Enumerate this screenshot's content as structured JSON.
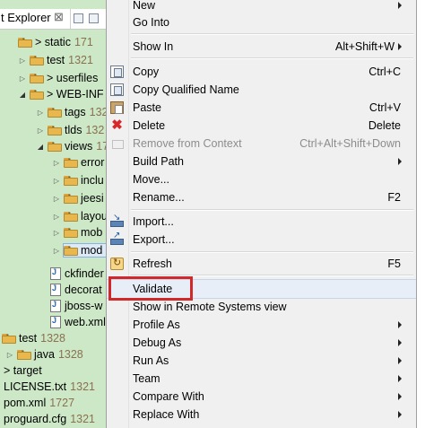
{
  "explorer": {
    "title": "t Explorer",
    "close_glyph": "⊠",
    "items": [
      {
        "name": "> static",
        "count": "171"
      },
      {
        "name": "test",
        "count": "1321"
      },
      {
        "name": "> userfiles",
        "count": ""
      },
      {
        "name": "> WEB-INF",
        "count": "17"
      },
      {
        "name": "tags",
        "count": "132"
      },
      {
        "name": "tlds",
        "count": "132"
      },
      {
        "name": "views",
        "count": "17"
      },
      {
        "name": "error",
        "count": ""
      },
      {
        "name": "inclu",
        "count": ""
      },
      {
        "name": "jeesi",
        "count": ""
      },
      {
        "name": "layou",
        "count": ""
      },
      {
        "name": "mob",
        "count": ""
      },
      {
        "name": "mod",
        "count": ""
      },
      {
        "name": "ckfinder",
        "count": ""
      },
      {
        "name": "decorat",
        "count": ""
      },
      {
        "name": "jboss-w",
        "count": ""
      },
      {
        "name": "web.xml",
        "count": ""
      },
      {
        "name": "test",
        "count": "1328"
      },
      {
        "name": "java",
        "count": "1328"
      },
      {
        "name": "> target",
        "count": ""
      },
      {
        "name": "LICENSE.txt",
        "count": "1321"
      },
      {
        "name": "pom.xml",
        "count": "1727"
      },
      {
        "name": "proguard.cfg",
        "count": "1321"
      }
    ]
  },
  "menu": {
    "new": {
      "label": "New"
    },
    "go_into": {
      "label": "Go Into"
    },
    "show_in": {
      "label": "Show In",
      "shortcut": "Alt+Shift+W"
    },
    "copy": {
      "label": "Copy",
      "shortcut": "Ctrl+C"
    },
    "copy_qualified": {
      "label": "Copy Qualified Name"
    },
    "paste": {
      "label": "Paste",
      "shortcut": "Ctrl+V"
    },
    "delete": {
      "label": "Delete",
      "shortcut": "Delete"
    },
    "remove_context": {
      "label": "Remove from Context",
      "shortcut": "Ctrl+Alt+Shift+Down"
    },
    "build_path": {
      "label": "Build Path"
    },
    "move": {
      "label": "Move..."
    },
    "rename": {
      "label": "Rename...",
      "shortcut": "F2"
    },
    "import": {
      "label": "Import..."
    },
    "export": {
      "label": "Export..."
    },
    "refresh": {
      "label": "Refresh",
      "shortcut": "F5"
    },
    "validate": {
      "label": "Validate"
    },
    "show_remote": {
      "label": "Show in Remote Systems view"
    },
    "profile_as": {
      "label": "Profile As"
    },
    "debug_as": {
      "label": "Debug As"
    },
    "run_as": {
      "label": "Run As"
    },
    "team": {
      "label": "Team"
    },
    "compare_with": {
      "label": "Compare With"
    },
    "replace_with": {
      "label": "Replace With"
    }
  },
  "colors": {
    "highlight_box": "#d3282a",
    "explorer_bg": "#cde8c7"
  }
}
